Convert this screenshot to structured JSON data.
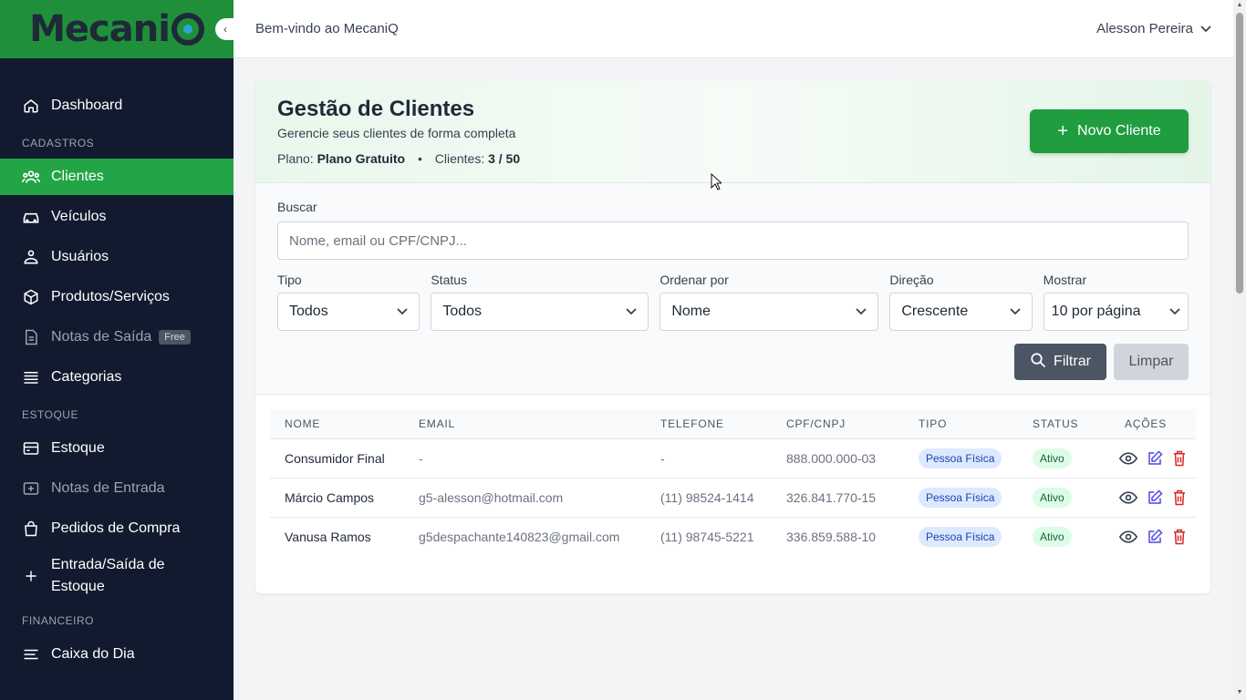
{
  "brand": {
    "logo_text": "Mecani",
    "collapse_glyph": "‹"
  },
  "topbar": {
    "welcome": "Bem-vindo ao MecaniQ",
    "user_name": "Alesson Pereira"
  },
  "sidebar": {
    "items": [
      {
        "label": "Dashboard",
        "icon": "home-icon"
      },
      {
        "section": "CADASTROS"
      },
      {
        "label": "Clientes",
        "icon": "users-icon",
        "active": true
      },
      {
        "label": "Veículos",
        "icon": "car-icon"
      },
      {
        "label": "Usuários",
        "icon": "user-icon"
      },
      {
        "label": "Produtos/Serviços",
        "icon": "box-icon"
      },
      {
        "label": "Notas de Saída",
        "icon": "document-icon",
        "badge": "Free",
        "muted": true
      },
      {
        "label": "Categorias",
        "icon": "list-icon"
      },
      {
        "section": "ESTOQUE"
      },
      {
        "label": "Estoque",
        "icon": "card-icon"
      },
      {
        "label": "Notas de Entrada",
        "icon": "plus-square-icon",
        "muted": true
      },
      {
        "label": "Pedidos de Compra",
        "icon": "bag-icon"
      },
      {
        "label": "Entrada/Saída de Estoque",
        "icon": "plus-icon"
      },
      {
        "section": "FINANCEIRO"
      },
      {
        "label": "Caixa do Dia",
        "icon": "lines-icon"
      }
    ]
  },
  "page": {
    "title": "Gestão de Clientes",
    "subtitle": "Gerencie seus clientes de forma completa",
    "plan_label": "Plano:",
    "plan_value": "Plano Gratuito",
    "sep": "•",
    "clients_label": "Clientes:",
    "clients_value": "3 / 50",
    "new_button": "Novo Cliente"
  },
  "filters": {
    "search_label": "Buscar",
    "search_placeholder": "Nome, email ou CPF/CNPJ...",
    "tipo": {
      "label": "Tipo",
      "value": "Todos"
    },
    "status": {
      "label": "Status",
      "value": "Todos"
    },
    "ordenar": {
      "label": "Ordenar por",
      "value": "Nome"
    },
    "direcao": {
      "label": "Direção",
      "value": "Crescente"
    },
    "mostrar": {
      "label": "Mostrar",
      "value": "10 por página"
    },
    "filter_button": "Filtrar",
    "clear_button": "Limpar"
  },
  "table": {
    "headers": [
      "NOME",
      "EMAIL",
      "TELEFONE",
      "CPF/CNPJ",
      "TIPO",
      "STATUS",
      "AÇÕES"
    ],
    "rows": [
      {
        "nome": "Consumidor Final",
        "email": "-",
        "telefone": "-",
        "cpf": "888.000.000-03",
        "tipo": "Pessoa Física",
        "status": "Ativo"
      },
      {
        "nome": "Márcio Campos",
        "email": "g5-alesson@hotmail.com",
        "telefone": "(11) 98524-1414",
        "cpf": "326.841.770-15",
        "tipo": "Pessoa Física",
        "status": "Ativo"
      },
      {
        "nome": "Vanusa Ramos",
        "email": "g5despachante140823@gmail.com",
        "telefone": "(11) 98745-5221",
        "cpf": "336.859.588-10",
        "tipo": "Pessoa Física",
        "status": "Ativo"
      }
    ]
  },
  "colors": {
    "brand_green": "#1f8f3a",
    "active_green": "#22a447",
    "sidebar_bg": "#111a2e",
    "button_green": "#1f9d3f"
  }
}
